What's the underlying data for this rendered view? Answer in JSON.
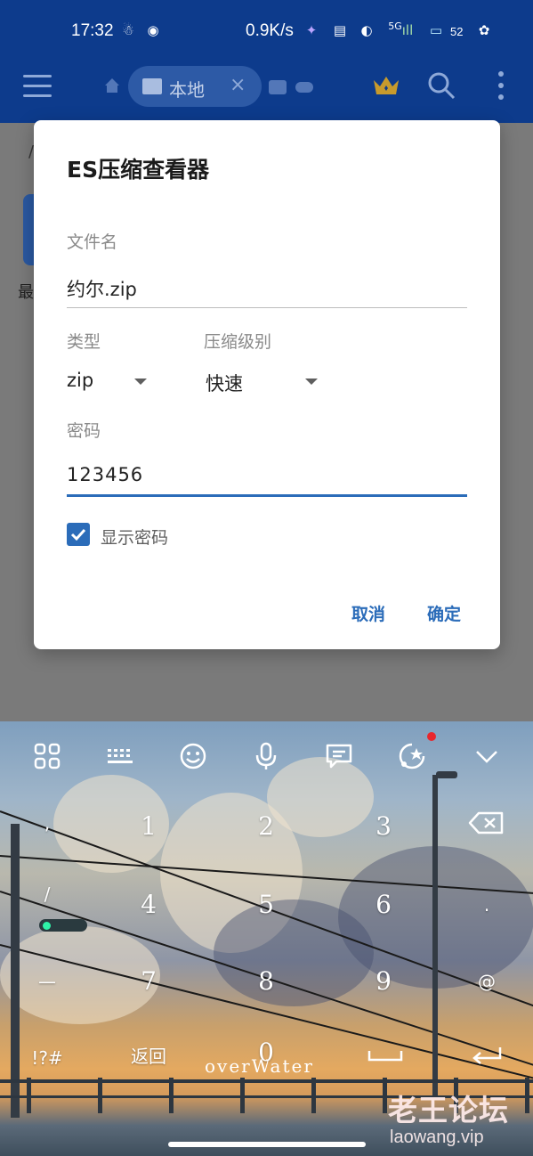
{
  "status_bar": {
    "time": "17:32",
    "net_speed": "0.9K/s",
    "signal": "5G",
    "battery": "52"
  },
  "app_bar": {
    "tab_label": "本地",
    "tab_close": "×"
  },
  "background": {
    "partial_label": "最",
    "breadcrumb_slash": "/"
  },
  "dialog": {
    "title": "ES压缩查看器",
    "filename_label": "文件名",
    "filename_value": "约尔.zip",
    "type_label": "类型",
    "type_value": "zip",
    "level_label": "压缩级别",
    "level_value": "快速",
    "password_label": "密码",
    "password_value": "123456",
    "show_password_label": "显示密码",
    "show_password_checked": true,
    "cancel_label": "取消",
    "ok_label": "确定"
  },
  "keyboard": {
    "keys_col1": [
      ",",
      "/",
      "—",
      "!?#"
    ],
    "digits": [
      "1",
      "2",
      "3",
      "4",
      "5",
      "6",
      "7",
      "8",
      "9",
      "0"
    ],
    "right_col": [
      ".",
      "@"
    ],
    "back_label": "返回",
    "space_brand": "overWater",
    "accent_dot": "#e8262c"
  },
  "watermark": {
    "title": "老王论坛",
    "url": "laowang.vip"
  }
}
